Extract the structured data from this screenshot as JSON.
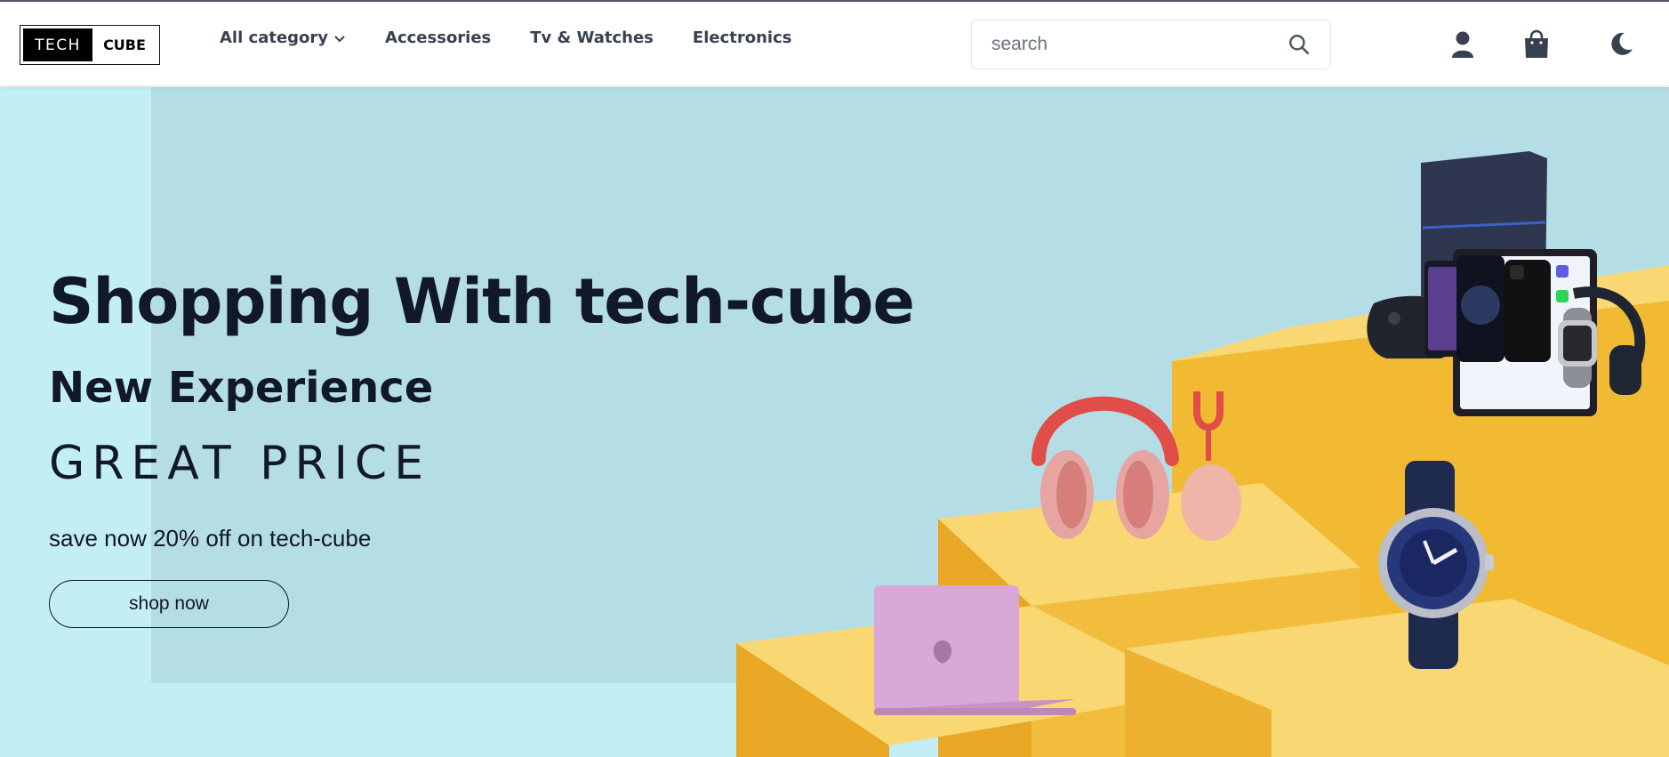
{
  "brand": {
    "logo_left": "TECH",
    "logo_right": "CUBE"
  },
  "nav": {
    "items": [
      {
        "label": "All category",
        "has_dropdown": true
      },
      {
        "label": "Accessories"
      },
      {
        "label": "Tv & Watches"
      },
      {
        "label": "Electronics"
      }
    ]
  },
  "search": {
    "placeholder": "search",
    "value": ""
  },
  "icons": {
    "account": "user-icon",
    "cart": "shopping-bag-icon",
    "theme": "moon-icon",
    "search": "search-icon"
  },
  "hero": {
    "title": "Shopping With tech-cube",
    "subtitle": "New Experience",
    "tagline": "GREAT PRICE",
    "offer": "save now 20% off on tech-cube",
    "cta": "shop now"
  },
  "colors": {
    "hero_bg": "#c4eef6",
    "wall": "#b5dde5",
    "podium": "#f5c842",
    "text": "#111827",
    "nav_text": "#374151"
  }
}
